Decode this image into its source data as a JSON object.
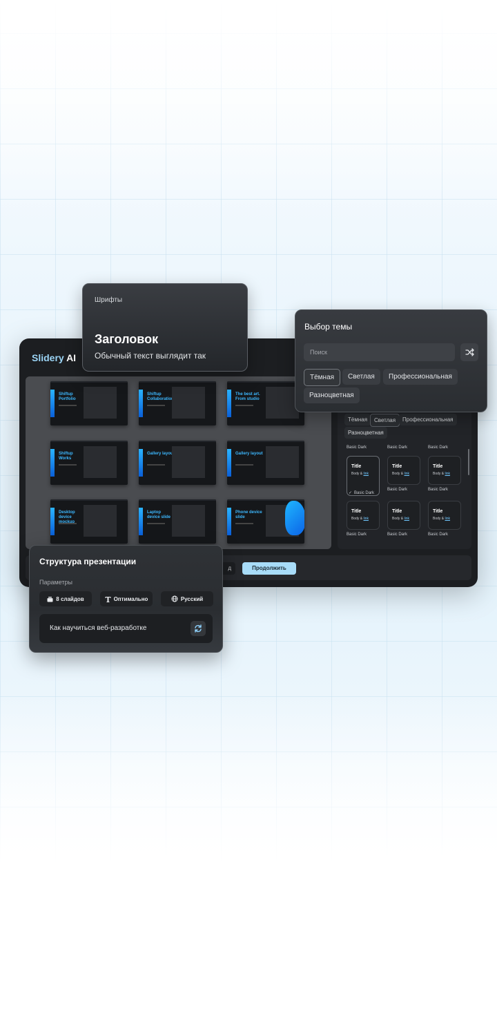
{
  "app": {
    "logo_brand": "Slidery",
    "logo_suffix": " AI"
  },
  "slides": [
    {
      "title": "Shiftup Portfolio"
    },
    {
      "title": "Shiftup Collaboration"
    },
    {
      "title": "The best art. From studio"
    },
    {
      "title": "Shiftup Works"
    },
    {
      "title": "Gallery layout"
    },
    {
      "title": "Gallery layout"
    },
    {
      "title": "Desktop device mockup"
    },
    {
      "title": "Laptop device slide"
    },
    {
      "title": "Phone device slide"
    }
  ],
  "theme_panel": {
    "tabs": [
      "Тёмная",
      "Светлая",
      "Профессиональная",
      "Разноцветная"
    ],
    "active_tab": "Светлая",
    "top_names": [
      "Basic Dark",
      "Basic Dark",
      "Basic Dark"
    ],
    "cards": [
      {
        "title": "Title",
        "body": "Body & ",
        "link": "link",
        "name": "Basic Dark",
        "selected": true
      },
      {
        "title": "Title",
        "body": "Body & ",
        "link": "link",
        "name": "Basic Dark",
        "selected": false
      },
      {
        "title": "Title",
        "body": "Body & ",
        "link": "link",
        "name": "Basic Dark",
        "selected": false
      },
      {
        "title": "Title",
        "body": "Body & ",
        "link": "link",
        "name": "Basic Dark",
        "selected": false
      },
      {
        "title": "Title",
        "body": "Body & ",
        "link": "link",
        "name": "Basic Dark",
        "selected": false
      },
      {
        "title": "Title",
        "body": "Body & ",
        "link": "link",
        "name": "Basic Dark",
        "selected": false
      }
    ]
  },
  "bottom_bar": {
    "prev_label": "д",
    "continue_label": "Продолжить"
  },
  "fonts_card": {
    "label": "Шрифты",
    "heading": "Заголовок",
    "body": "Обычный текст выглядит так"
  },
  "theme_card": {
    "title": "Выбор темы",
    "search_placeholder": "Поиск",
    "tabs": [
      "Тёмная",
      "Светлая",
      "Профессиональная",
      "Разноцветная"
    ],
    "active_tab": "Тёмная"
  },
  "structure_card": {
    "title": "Структура презентации",
    "params_label": "Параметры",
    "slides_count": "8 слайдов",
    "text_amount": "Оптимально",
    "language": "Русский",
    "prompt": "Как научиться веб-разработке"
  },
  "colors": {
    "accent": "#a8dcf8",
    "slide_accent": "#2ab3ff"
  },
  "icons": {
    "shuffle": "shuffle-icon",
    "refresh": "refresh-icon",
    "slides": "stack-icon",
    "text": "text-t-icon",
    "language": "globe-icon",
    "check": "check-icon"
  }
}
